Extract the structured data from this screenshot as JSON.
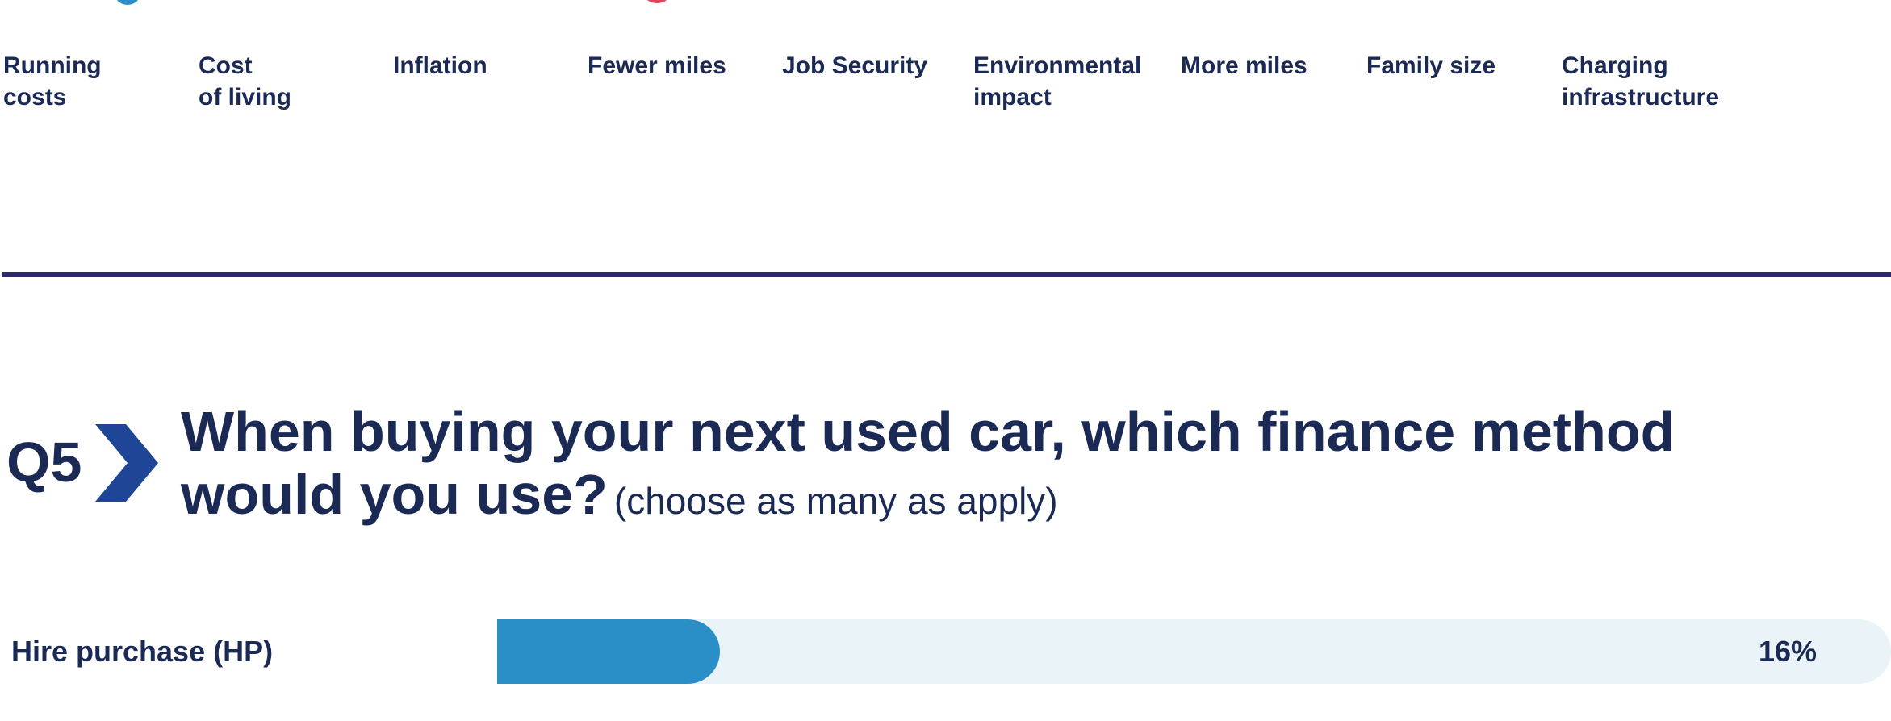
{
  "factors": [
    {
      "line1": "Running",
      "line2": "costs"
    },
    {
      "line1": "Cost",
      "line2": "of living"
    },
    {
      "line1": "Inflation",
      "line2": ""
    },
    {
      "line1": "Fewer miles",
      "line2": ""
    },
    {
      "line1": "Job Security",
      "line2": ""
    },
    {
      "line1": "Environmental",
      "line2": "impact"
    },
    {
      "line1": "More miles",
      "line2": ""
    },
    {
      "line1": "Family size",
      "line2": ""
    },
    {
      "line1": "Charging",
      "line2": "infrastructure"
    }
  ],
  "question": {
    "number": "Q5",
    "line1": "When buying your next used car, which finance method",
    "line2": "would you use?",
    "note": "(choose as many as apply)"
  },
  "icons": {
    "question_marker": "chevron-right-icon"
  },
  "colors": {
    "navy": "#1b2a55",
    "divider": "#2c2a6b",
    "bar_fill": "#2a8fc6",
    "bar_track": "#eaf3f8"
  },
  "chart_data": {
    "type": "bar",
    "orientation": "horizontal",
    "categories": [
      "Hire purchase (HP)"
    ],
    "values": [
      16
    ],
    "value_labels": [
      "16%"
    ],
    "xlim": [
      0,
      100
    ]
  }
}
